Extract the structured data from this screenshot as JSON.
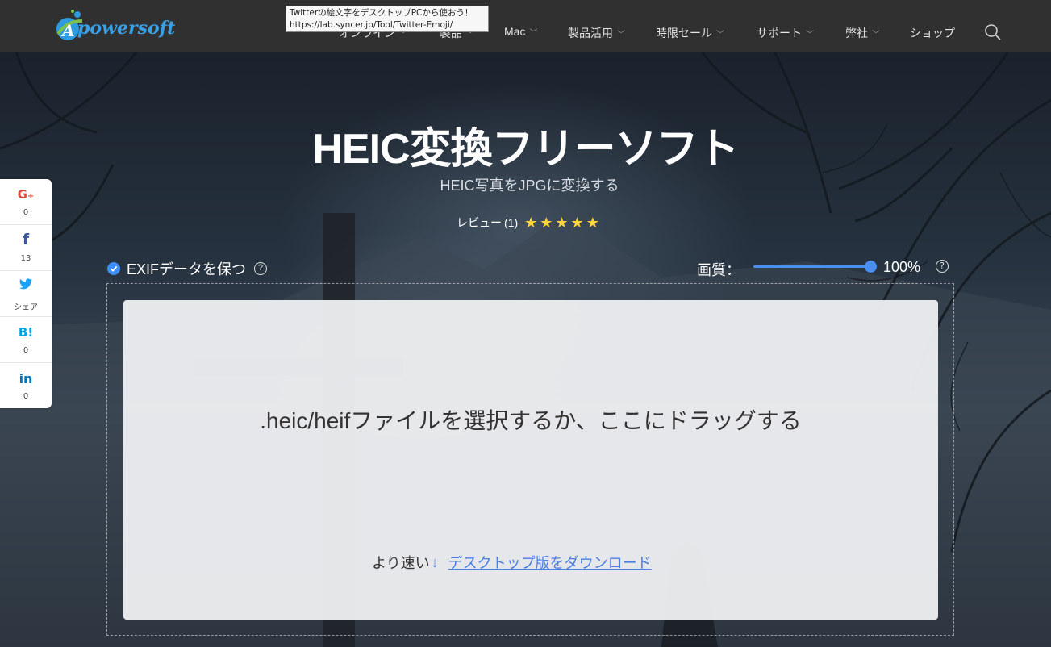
{
  "nav": {
    "logo": "powersoft",
    "items": [
      {
        "label": "オンライン",
        "chevron": true
      },
      {
        "label": "製品",
        "chevron": true
      },
      {
        "label": "Mac",
        "chevron": true
      },
      {
        "label": "製品活用",
        "chevron": true
      },
      {
        "label": "時限セール",
        "chevron": true
      },
      {
        "label": "サポート",
        "chevron": true
      },
      {
        "label": "弊社",
        "chevron": true
      },
      {
        "label": "ショップ",
        "chevron": false
      }
    ],
    "search_icon": "search-icon"
  },
  "tooltip": {
    "line1": "Twitterの絵文字をデスクトップPCから使おう！",
    "line2": "https://lab.syncer.jp/Tool/Twitter-Emoji/"
  },
  "hero": {
    "title": "HEIC変換フリーソフト",
    "subtitle": "HEIC写真をJPGに変換する",
    "review_label": "レビュー",
    "review_count": "(1)",
    "stars": 5
  },
  "options": {
    "exif_label": "EXIFデータを保つ",
    "exif_checked": true,
    "quality_label": "画質：",
    "quality_value": "100%",
    "quality_level": 1.0
  },
  "dropzone": {
    "prompt": ".heic/heifファイルを選択するか、ここにドラッグする",
    "faster_label": "より速い",
    "download_link": "デスクトップ版をダウンロード"
  },
  "share": [
    {
      "icon": "google-plus-icon",
      "symbol": "G+",
      "count": "0",
      "color": "#dd4b39"
    },
    {
      "icon": "facebook-icon",
      "symbol": "f",
      "count": "13",
      "color": "#3b5998"
    },
    {
      "icon": "twitter-icon",
      "symbol": "🐦",
      "count": "シェア",
      "color": "#1da1f2"
    },
    {
      "icon": "hatena-bookmark-icon",
      "symbol": "B!",
      "count": "0",
      "color": "#00a4de"
    },
    {
      "icon": "linkedin-icon",
      "symbol": "in",
      "count": "0",
      "color": "#0077b5"
    }
  ],
  "colors": {
    "accent": "#4a8ff0",
    "star": "#ffd43b",
    "nav_bg": "#303030"
  }
}
